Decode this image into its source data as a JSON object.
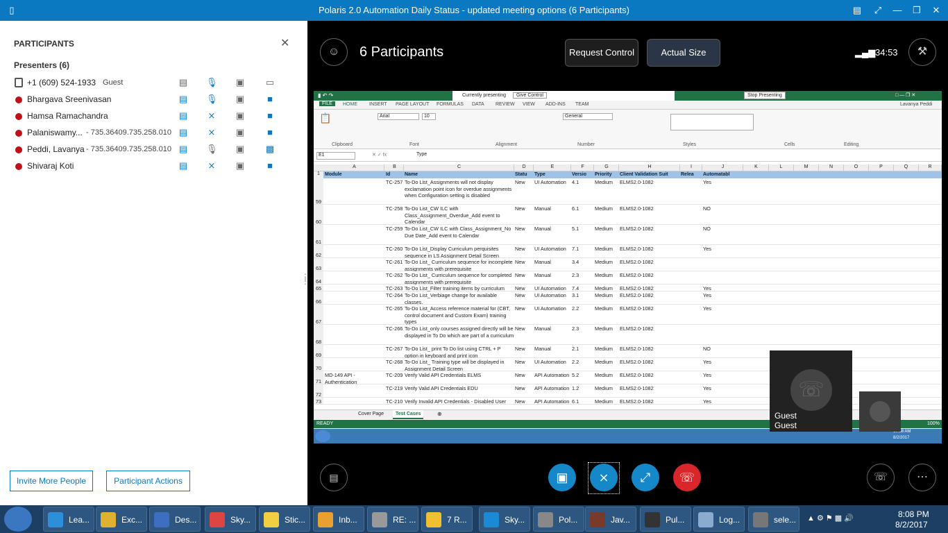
{
  "window": {
    "title": "Polaris 2.0 Automation Daily Status - updated meeting options (6 Participants)"
  },
  "participants_panel": {
    "title": "PARTICIPANTS",
    "presenters_heading": "Presenters (6)",
    "people": [
      {
        "name": "+1 (609) 524-1933",
        "tag": "Guest"
      },
      {
        "name": "Bhargava Sreenivasan",
        "tag": ""
      },
      {
        "name": "Hamsa Ramachandra",
        "tag": ""
      },
      {
        "name": "Palaniswamy...",
        "tag": "- 735.36409.735.258.010"
      },
      {
        "name": "Peddi, Lavanya",
        "tag": "- 735.36409.735.258.010"
      },
      {
        "name": "Shivaraj Koti",
        "tag": ""
      }
    ],
    "invite_label": "Invite More People",
    "actions_label": "Participant Actions"
  },
  "stage": {
    "participants_count": "6 Participants",
    "request_control": "Request Control",
    "actual_size": "Actual Size",
    "timer": "34:53",
    "guest_label_1": "Guest",
    "guest_label_2": "Guest"
  },
  "excel": {
    "presenting": "Currently presenting",
    "give_control": "Give Control",
    "stop_presenting": "Stop Presenting",
    "user": "Lavanya Peddi",
    "tabs": [
      "FILE",
      "HOME",
      "INSERT",
      "PAGE LAYOUT",
      "FORMULAS",
      "DATA",
      "REVIEW",
      "VIEW",
      "ADD-INS",
      "TEAM"
    ],
    "font": "Arial",
    "font_size": "10",
    "number_format": "General",
    "groups": [
      "Clipboard",
      "Font",
      "Alignment",
      "Number",
      "Styles",
      "Cells",
      "Editing"
    ],
    "cell_ref": "E1",
    "formula": "Type",
    "columns": [
      "A",
      "B",
      "C",
      "D",
      "E",
      "F",
      "G",
      "H",
      "I",
      "J",
      "K",
      "L",
      "M",
      "N",
      "O",
      "P",
      "Q",
      "R"
    ],
    "headers": [
      "Module",
      "Id",
      "Name",
      "Statu",
      "Type",
      "Versio",
      "Priority",
      "Client Validation Suit",
      "Relea",
      "Automatabl"
    ],
    "rows": [
      {
        "n": "59",
        "module": "",
        "id": "TC-257",
        "name": "To-Do List_Assignments will not display exclamation point icon for overdue assignments when Configuration setting is disabled",
        "status": "New",
        "type": "UI Automation",
        "ver": "4.1",
        "pri": "Medium",
        "client": "ELMS2.0-1082",
        "auto": "Yes"
      },
      {
        "n": "60",
        "module": "",
        "id": "TC-258",
        "name": "To-Do List_CW ILC with Class_Assignment_Overdue_Add event to Calendar",
        "status": "New",
        "type": "Manual",
        "ver": "6.1",
        "pri": "Medium",
        "client": "ELMS2.0-1082",
        "auto": "NO"
      },
      {
        "n": "61",
        "module": "",
        "id": "TC-259",
        "name": "To-Do List_CW ILC with Class_Assignment_No Due Date_Add event to Calendar",
        "status": "New",
        "type": "Manual",
        "ver": "5.1",
        "pri": "Medium",
        "client": "ELMS2.0-1082",
        "auto": "NO"
      },
      {
        "n": "62",
        "module": "",
        "id": "TC-260",
        "name": "To-Do List_Display  Curriculum perquisites sequence in LS Assignment Detail Screen",
        "status": "New",
        "type": "UI Automation",
        "ver": "7.1",
        "pri": "Medium",
        "client": "ELMS2.0-1082",
        "auto": "Yes"
      },
      {
        "n": "63",
        "module": "",
        "id": "TC-261",
        "name": "To-Do List_ Curriculum sequence for incomplete assignments with prerequisite",
        "status": "New",
        "type": "Manual",
        "ver": "3.4",
        "pri": "Medium",
        "client": "ELMS2.0-1082",
        "auto": ""
      },
      {
        "n": "64",
        "module": "",
        "id": "TC-262",
        "name": "To-Do List_ Curriculum sequence for completed assignments with prerequisite",
        "status": "New",
        "type": "Manual",
        "ver": "2.3",
        "pri": "Medium",
        "client": "ELMS2.0-1082",
        "auto": ""
      },
      {
        "n": "65",
        "module": "",
        "id": "TC-263",
        "name": "To-Do List_Filter training items by curriculum",
        "status": "New",
        "type": "UI Automation",
        "ver": "7.4",
        "pri": "Medium",
        "client": "ELMS2.0-1082",
        "auto": "Yes"
      },
      {
        "n": "66",
        "module": "",
        "id": "TC-264",
        "name": "To-Do List_Verbiage change for available classes.",
        "status": "New",
        "type": "UI Automation",
        "ver": "3.1",
        "pri": "Medium",
        "client": "ELMS2.0-1082",
        "auto": "Yes"
      },
      {
        "n": "67",
        "module": "",
        "id": "TC-265",
        "name": "To-Do List_Access reference material for (CBT, control document and Custom Exam) training types",
        "status": "New",
        "type": "UI Automation",
        "ver": "2.2",
        "pri": "Medium",
        "client": "ELMS2.0-1082",
        "auto": "Yes"
      },
      {
        "n": "68",
        "module": "",
        "id": "TC-266",
        "name": "To-Do List_only courses assigned directly will be displayed in To Do which are part of a curriculum",
        "status": "New",
        "type": "Manual",
        "ver": "2.3",
        "pri": "Medium",
        "client": "ELMS2.0-1082",
        "auto": ""
      },
      {
        "n": "69",
        "module": "",
        "id": "TC-267",
        "name": "To-Do List_ print To Do list using CTRL + P option in keyboard and print icon",
        "status": "New",
        "type": "Manual",
        "ver": "2.1",
        "pri": "Medium",
        "client": "ELMS2.0-1082",
        "auto": "NO"
      },
      {
        "n": "70",
        "module": "",
        "id": "TC-268",
        "name": "To-Do List_ Training type will be displayed in Assignment Detail Screen",
        "status": "New",
        "type": "UI Automation",
        "ver": "2.2",
        "pri": "Medium",
        "client": "ELMS2.0-1082",
        "auto": "Yes"
      },
      {
        "n": "71",
        "module": "MD-149 API - Authentication",
        "id": "TC-209",
        "name": "Verify Valid API Credentials ELMS",
        "status": "New",
        "type": "API Automation",
        "ver": "5.2",
        "pri": "Medium",
        "client": "ELMS2.0-1082",
        "auto": "Yes"
      },
      {
        "n": "72",
        "module": "",
        "id": "TC-219",
        "name": "Verify Valid API Credentials EDU",
        "status": "New",
        "type": "API Automation",
        "ver": "1.2",
        "pri": "Medium",
        "client": "ELMS2.0-1082",
        "auto": "Yes"
      },
      {
        "n": "73",
        "module": "",
        "id": "TC-210",
        "name": "Verify Invalid API Credentials - Disabled User",
        "status": "New",
        "type": "API Automation",
        "ver": "6.1",
        "pri": "Medium",
        "client": "ELMS2.0-1082",
        "auto": "Yes"
      }
    ],
    "sheet_tabs": [
      "Cover Page",
      "Test Cases"
    ],
    "status": "READY",
    "zoom": "100%",
    "remote_time": "10:38 AM",
    "remote_date": "8/2/2017"
  },
  "taskbar": {
    "items": [
      "Lea...",
      "Exc...",
      "Des...",
      "Sky...",
      "Stic...",
      "Inb...",
      "RE: ...",
      "7 R...",
      "Sky...",
      "Pol...",
      "Jav...",
      "Pul...",
      "Log...",
      "sele..."
    ],
    "time": "8:08 PM",
    "date": "8/2/2017"
  }
}
